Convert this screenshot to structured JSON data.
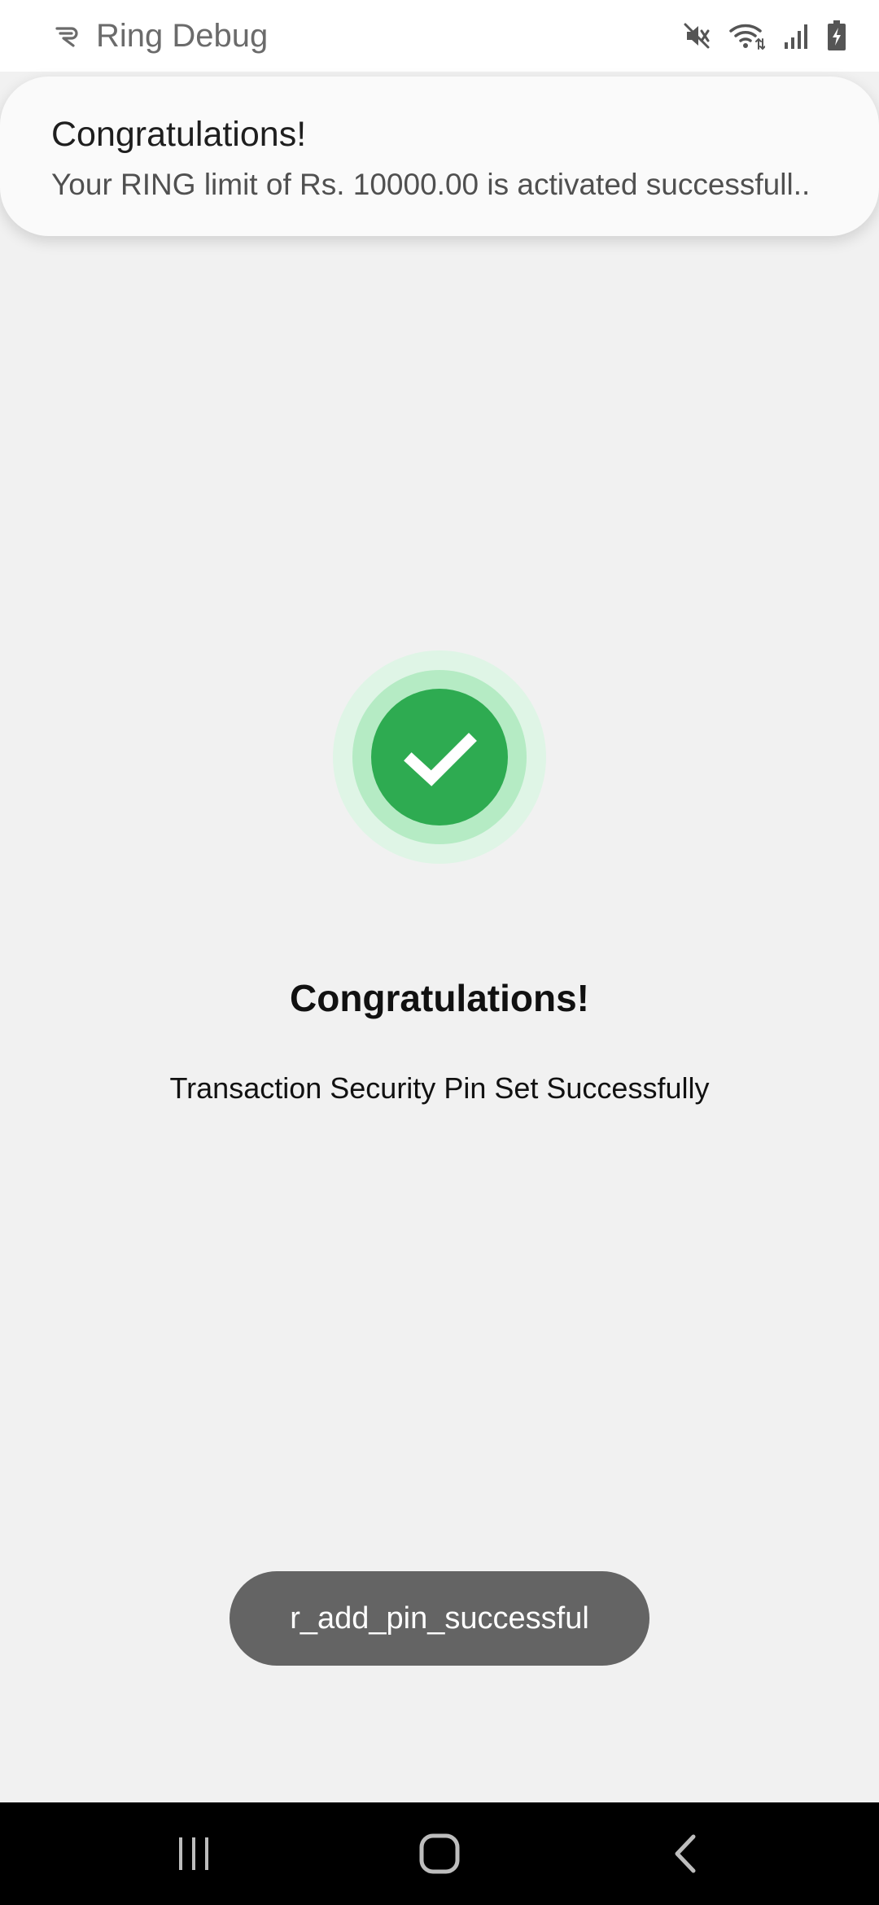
{
  "status_bar": {
    "app_title": "Ring Debug",
    "icons": [
      "ring-app-icon",
      "mute-icon",
      "wifi-icon",
      "signal-icon",
      "battery-icon"
    ]
  },
  "notification": {
    "title": "Congratulations!",
    "body": "Your RING limit of Rs. 10000.00 is activated successfull.."
  },
  "main": {
    "heading": "Congratulations!",
    "message": "Transaction Security Pin Set Successfully",
    "success_icon": "check-circle-icon"
  },
  "toast": {
    "text": "r_add_pin_successful"
  },
  "nav_bar": {
    "buttons": [
      "recent-apps",
      "home",
      "back"
    ]
  },
  "colors": {
    "success_green": "#2eab51",
    "ring_middle": "#b5ebc4",
    "ring_outer": "#dff5e6",
    "toast_bg": "#646464",
    "background": "#f1f1f1"
  }
}
